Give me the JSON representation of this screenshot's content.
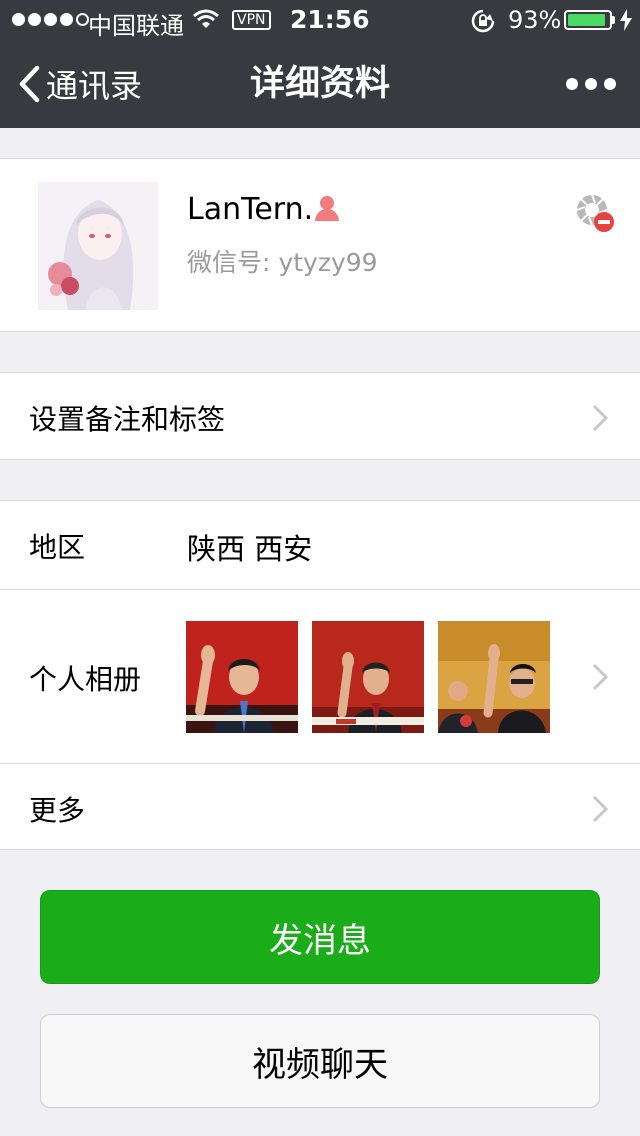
{
  "status_bar": {
    "carrier": "中国联通",
    "vpn": "VPN",
    "time": "21:56",
    "battery_percent": "93%",
    "battery_level": 0.93
  },
  "nav": {
    "back_label": "通讯录",
    "title": "详细资料"
  },
  "profile": {
    "nickname": "LanTern.",
    "wechat_id_label": "微信号:",
    "wechat_id": "ytyzy99"
  },
  "remark": {
    "label": "设置备注和标签"
  },
  "info": {
    "region_label": "地区",
    "region_value": "陕西 西安",
    "album_label": "个人相册",
    "more_label": "更多"
  },
  "actions": {
    "send_message": "发消息",
    "video_chat": "视频聊天"
  },
  "colors": {
    "nav_bg": "#393a3f",
    "primary_green": "#1aad19",
    "battery_green": "#4cd964",
    "page_bg": "#efeff4"
  }
}
